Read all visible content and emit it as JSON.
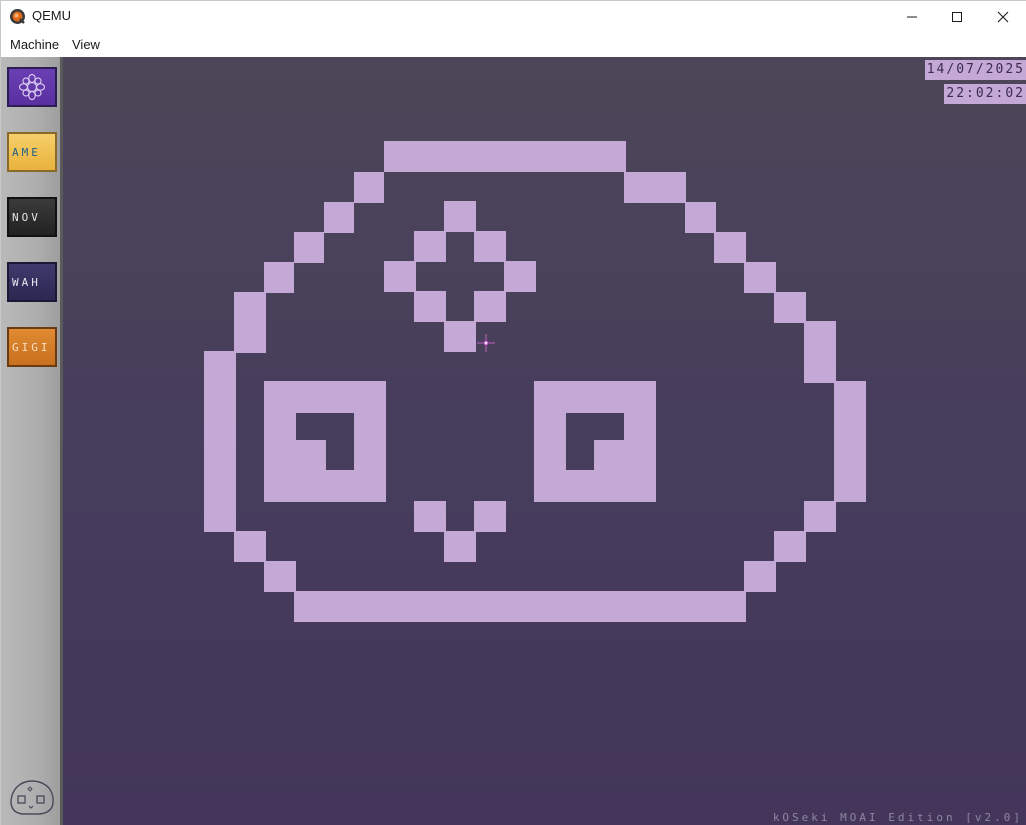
{
  "window": {
    "title": "QEMU",
    "icons": {
      "app": "qemu-app-icon",
      "minimize": "minimize-icon",
      "maximize": "maximize-icon",
      "close": "close-icon"
    }
  },
  "menubar": {
    "items": [
      {
        "label": "Machine"
      },
      {
        "label": "View"
      }
    ]
  },
  "guest": {
    "background_color": "#463c5c",
    "accent_color": "#c4a8d6",
    "sidebar": {
      "buttons": [
        {
          "label": "",
          "icon": "settings-flower-icon",
          "color": "#5a2fa0"
        },
        {
          "label": "AME",
          "color": "#e9b23c"
        },
        {
          "label": "NOV",
          "color": "#222222"
        },
        {
          "label": "WAH",
          "color": "#2c2852"
        },
        {
          "label": "GIGI",
          "color": "#c8701e"
        }
      ],
      "bottom_icon": "moai-face-logo-icon"
    },
    "date": "14/07/2025",
    "time": "22:02:02",
    "footer": "kOSeki MOAI Edition [v2.0]",
    "center_graphic": "moai-face-icon",
    "cursor": "crosshair-cursor-icon"
  }
}
